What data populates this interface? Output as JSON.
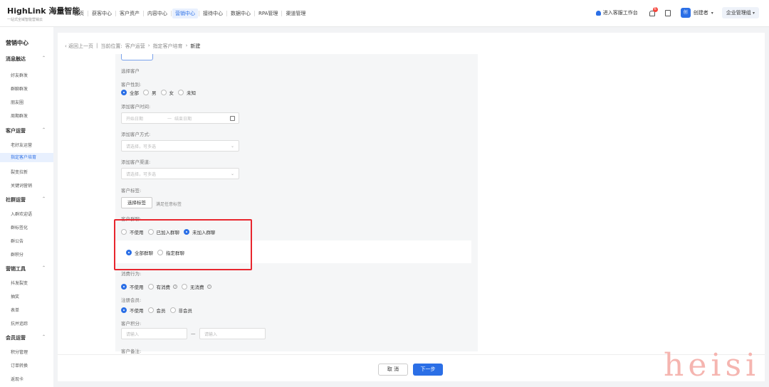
{
  "header": {
    "logo_main": "HighLink 海量智能",
    "logo_sub": "一站式全域智能营销云",
    "nav": [
      "首页",
      "获客中心",
      "客户资产",
      "内容中心",
      "营销中心",
      "接待中心",
      "数据中心",
      "RPA管理",
      "渠道管理"
    ],
    "active_nav": "营销中心",
    "workbench": "进入客服工作台",
    "notification_count": "6",
    "avatar_text": "创",
    "user_name": "创建者",
    "org": "企业管理组"
  },
  "sidebar": {
    "title": "营销中心",
    "items": [
      {
        "label": "消息触达",
        "type": "group"
      },
      {
        "label": "好友群发",
        "type": "sub"
      },
      {
        "label": "群聊群发",
        "type": "sub"
      },
      {
        "label": "朋友圈",
        "type": "sub"
      },
      {
        "label": "周期群发",
        "type": "sub"
      },
      {
        "label": "客户运营",
        "type": "group"
      },
      {
        "label": "老好友运营",
        "type": "sub"
      },
      {
        "label": "指定客户培育",
        "type": "sub",
        "active": true
      },
      {
        "label": "裂变拉新",
        "type": "sub"
      },
      {
        "label": "关键词营销",
        "type": "sub"
      },
      {
        "label": "社群运营",
        "type": "group"
      },
      {
        "label": "入群欢迎语",
        "type": "sub"
      },
      {
        "label": "群标签化",
        "type": "sub"
      },
      {
        "label": "群公告",
        "type": "sub"
      },
      {
        "label": "群积分",
        "type": "sub"
      },
      {
        "label": "营销工具",
        "type": "group"
      },
      {
        "label": "抖发裂变",
        "type": "sub"
      },
      {
        "label": "抽奖",
        "type": "sub"
      },
      {
        "label": "表单",
        "type": "sub"
      },
      {
        "label": "抗并追踪",
        "type": "sub"
      },
      {
        "label": "会员运营",
        "type": "group"
      },
      {
        "label": "积分管理",
        "type": "sub"
      },
      {
        "label": "订单转换",
        "type": "sub"
      },
      {
        "label": "返现卡",
        "type": "sub"
      }
    ]
  },
  "breadcrumb": {
    "back": "返回上一页",
    "location_label": "当前位置:",
    "path": [
      "客户运营",
      "指定客户培育"
    ],
    "current": "新建"
  },
  "form": {
    "select_customer_label": "选择客户",
    "gender_label": "客户性别:",
    "gender_options": [
      "全部",
      "男",
      "女",
      "未知"
    ],
    "gender_selected": 0,
    "add_time_label": "添加客户时间:",
    "start_date_placeholder": "开始日期",
    "date_sep": "—",
    "end_date_placeholder": "结束日期",
    "add_method_label": "添加客户方式:",
    "add_method_placeholder": "请选择，可多选",
    "add_channel_label": "添加客户渠道:",
    "add_channel_placeholder": "请选择，可多选",
    "tag_label": "客户标签:",
    "tag_button": "选择标签",
    "tag_hint": "满足任意标签",
    "group_label": "客户群聊:",
    "group_options": [
      "不使用",
      "已加入群聊",
      "未加入群聊"
    ],
    "group_selected": 2,
    "group_scope_options": [
      "全部群聊",
      "指定群聊"
    ],
    "group_scope_selected": 0,
    "consume_label": "消费行为:",
    "consume_options": [
      "不使用",
      "有消费",
      "无消费"
    ],
    "consume_selected": 0,
    "member_label": "注册会员:",
    "member_options": [
      "不使用",
      "会员",
      "非会员"
    ],
    "member_selected": 0,
    "points_label": "客户积分:",
    "points_min_placeholder": "请输入",
    "points_sep": "—",
    "points_max_placeholder": "请输入",
    "remark_label": "客户备注:"
  },
  "footer": {
    "cancel": "取 消",
    "next": "下一步"
  },
  "watermark": "heisi",
  "colors": {
    "accent": "#2b6fe6",
    "highlight_box": "#e8262e"
  }
}
